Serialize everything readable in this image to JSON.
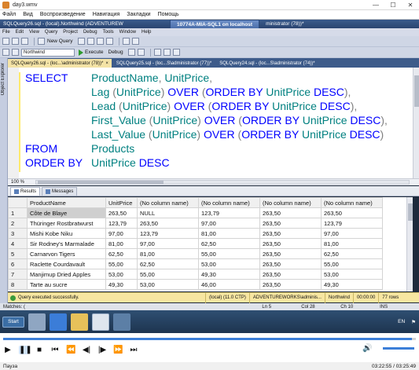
{
  "player": {
    "title": "day3.wmv",
    "menu": [
      "Файл",
      "Вид",
      "Воспроизведение",
      "Навигация",
      "Закладки",
      "Помощь"
    ],
    "status": "Пауза",
    "time": "03:22:55 / 03:25:49",
    "progress_percent": 99
  },
  "vm": {
    "ssms_title": "SQLQuery26.sql - (local).Northwind (ADVENTUREW",
    "rdp_title": "10774A-MIA-SQL1 on localhost",
    "rdp_right": "ministrator (78))*"
  },
  "ssms_menu": [
    "File",
    "Edit",
    "View",
    "Query",
    "Project",
    "Debug",
    "Tools",
    "Window",
    "Help"
  ],
  "toolbar": {
    "new_query": "New Query",
    "database": "Northwind",
    "execute": "Execute",
    "debug": "Debug"
  },
  "object_explorer_label": "Object Explorer",
  "doc_tabs": [
    {
      "label": "SQLQuery26.sql - (loc...\\administrator (78))*"
    },
    {
      "label": "SQLQuery25.sql - (loc...S\\administrator (77))*"
    },
    {
      "label": "SQLQuery24.sql - (loc...S\\administrator (74))*"
    }
  ],
  "editor": {
    "lines": [
      {
        "kw": "SELECT",
        "rest": [
          {
            "t": "ProductName",
            "c": "id"
          },
          {
            "t": ", ",
            "c": "pu"
          },
          {
            "t": "UnitPrice",
            "c": "id"
          },
          {
            "t": ",",
            "c": "pu"
          }
        ]
      },
      {
        "kw": "",
        "rest": [
          {
            "t": "Lag ",
            "c": "fn"
          },
          {
            "t": "(",
            "c": "pu"
          },
          {
            "t": "UnitPrice",
            "c": "id"
          },
          {
            "t": ") ",
            "c": "pu"
          },
          {
            "t": "OVER ",
            "c": "kw"
          },
          {
            "t": "(",
            "c": "pu"
          },
          {
            "t": "ORDER BY ",
            "c": "kw"
          },
          {
            "t": "UnitPrice ",
            "c": "id"
          },
          {
            "t": "DESC",
            "c": "kw"
          },
          {
            "t": "),",
            "c": "pu"
          }
        ]
      },
      {
        "kw": "",
        "rest": [
          {
            "t": "Lead ",
            "c": "fn"
          },
          {
            "t": "(",
            "c": "pu"
          },
          {
            "t": "UnitPrice",
            "c": "id"
          },
          {
            "t": ") ",
            "c": "pu"
          },
          {
            "t": "OVER ",
            "c": "kw"
          },
          {
            "t": "(",
            "c": "pu"
          },
          {
            "t": "ORDER BY ",
            "c": "kw"
          },
          {
            "t": "UnitPrice ",
            "c": "id"
          },
          {
            "t": "DESC",
            "c": "kw"
          },
          {
            "t": "),",
            "c": "pu"
          }
        ]
      },
      {
        "kw": "",
        "rest": [
          {
            "t": "First_Value ",
            "c": "fn"
          },
          {
            "t": "(",
            "c": "pu"
          },
          {
            "t": "UnitPrice",
            "c": "id"
          },
          {
            "t": ") ",
            "c": "pu"
          },
          {
            "t": "OVER ",
            "c": "kw"
          },
          {
            "t": "(",
            "c": "pu"
          },
          {
            "t": "ORDER BY ",
            "c": "kw"
          },
          {
            "t": "UnitPrice ",
            "c": "id"
          },
          {
            "t": "DESC",
            "c": "kw"
          },
          {
            "t": "),",
            "c": "pu"
          }
        ]
      },
      {
        "kw": "",
        "rest": [
          {
            "t": "Last_Value ",
            "c": "fn"
          },
          {
            "t": "(",
            "c": "pu"
          },
          {
            "t": "UnitPrice",
            "c": "id"
          },
          {
            "t": ") ",
            "c": "pu"
          },
          {
            "t": "OVER ",
            "c": "kw"
          },
          {
            "t": "(",
            "c": "pu"
          },
          {
            "t": "ORDER BY ",
            "c": "kw"
          },
          {
            "t": "UnitPrice ",
            "c": "id"
          },
          {
            "t": "DESC",
            "c": "kw"
          },
          {
            "t": ")",
            "c": "pu"
          }
        ]
      },
      {
        "kw": "FROM",
        "rest": [
          {
            "t": "Products",
            "c": "id"
          }
        ]
      },
      {
        "kw": "ORDER BY",
        "rest": [
          {
            "t": "UnitPrice ",
            "c": "id"
          },
          {
            "t": "DESC",
            "c": "kw"
          }
        ]
      }
    ]
  },
  "zoom": "100 %",
  "result_tabs": [
    "Results",
    "Messages"
  ],
  "grid": {
    "columns": [
      "",
      "ProductName",
      "UnitPrice",
      "(No column name)",
      "(No column name)",
      "(No column name)",
      "(No column name)"
    ],
    "rows": [
      [
        "1",
        "Côte de Blaye",
        "263,50",
        "NULL",
        "123,79",
        "263,50",
        "263,50"
      ],
      [
        "2",
        "Thüringer Rostbratwurst",
        "123,79",
        "263,50",
        "97,00",
        "263,50",
        "123,79"
      ],
      [
        "3",
        "Mishi Kobe Niku",
        "97,00",
        "123,79",
        "81,00",
        "263,50",
        "97,00"
      ],
      [
        "4",
        "Sir Rodney's Marmalade",
        "81,00",
        "97,00",
        "62,50",
        "263,50",
        "81,00"
      ],
      [
        "5",
        "Carnarvon Tigers",
        "62,50",
        "81,00",
        "55,00",
        "263,50",
        "62,50"
      ],
      [
        "6",
        "Raclette Courdavault",
        "55,00",
        "62,50",
        "53,00",
        "263,50",
        "55,00"
      ],
      [
        "7",
        "Manjimup Dried Apples",
        "53,00",
        "55,00",
        "49,30",
        "263,50",
        "53,00"
      ],
      [
        "8",
        "Tarte au sucre",
        "49,30",
        "53,00",
        "46,00",
        "263,50",
        "49,30"
      ]
    ]
  },
  "query_status": {
    "message": "Query executed successfully.",
    "server": "(local) (11.0 CTP)",
    "user": "ADVENTUREWORKS\\adminis...",
    "database": "Northwind",
    "elapsed": "00:00:00",
    "rows": "77 rows"
  },
  "status_line": {
    "matches": "Matches: (",
    "ln": "Ln 5",
    "col": "Col 28",
    "ch": "Ch 10",
    "ins": "INS"
  },
  "taskbar": {
    "start": "Start",
    "lang": "EN"
  }
}
